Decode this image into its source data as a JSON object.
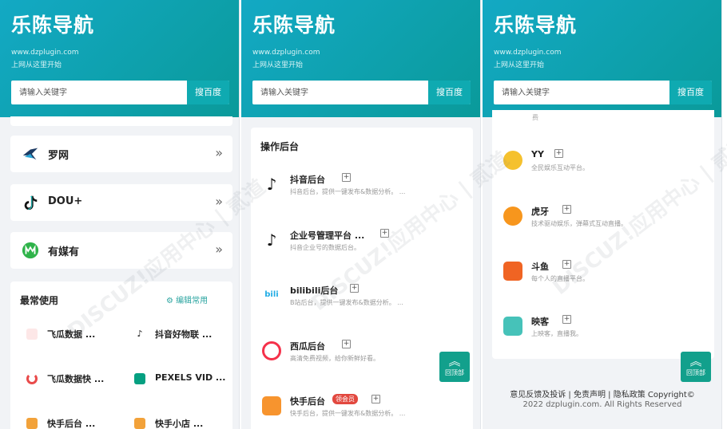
{
  "site": {
    "brand": "乐陈导航",
    "url": "www.dzplugin.com",
    "slogan": "上网从这里开始",
    "search_placeholder": "请输入关键字",
    "search_button": "搜百度"
  },
  "panel1": {
    "nav_cards": [
      {
        "label": "罗网",
        "icon": "luowang-logo-icon"
      },
      {
        "label": "DOU+",
        "icon": "tiktok-icon"
      },
      {
        "label": "有媒有",
        "icon": "youmeiyou-logo-icon"
      }
    ],
    "frequent": {
      "title": "最常使用",
      "edit_label": "编辑常用",
      "items": [
        {
          "label": "飞瓜数据 ...",
          "color": "#e94b4b"
        },
        {
          "label": "抖音好物联 ...",
          "color": "#111111"
        },
        {
          "label": "飞瓜数据快 ...",
          "color": "#e94b4b"
        },
        {
          "label": "PEXELS VID ...",
          "color": "#05a081"
        },
        {
          "label": "快手后台 ...",
          "color": "#f2a23a"
        },
        {
          "label": "快手小店 ...",
          "color": "#f2a23a"
        }
      ]
    }
  },
  "panel2": {
    "section_title": "操作后台",
    "items": [
      {
        "title": "抖音后台",
        "desc": "抖音后台，提供一键发布&数据分析。 ...",
        "color": "#111111"
      },
      {
        "title": "企业号管理平台 ...",
        "desc": "抖音企业号的数据后台。",
        "color": "#111111"
      },
      {
        "title": "bilibili后台",
        "desc": "B站后台，提供一键发布&数据分析。 ...",
        "color": "#23ade5"
      },
      {
        "title": "西瓜后台",
        "desc": "高清免费视频，给你新鲜好看。",
        "color": "#f5314a"
      },
      {
        "title": "快手后台",
        "tag": "领会员",
        "desc": "快手后台，提供一键发布&数据分析。 ...",
        "color": "#f7942e"
      }
    ],
    "to_top": "回顶部"
  },
  "panel3": {
    "top_cut_text": "费",
    "items": [
      {
        "title": "YY",
        "desc": "全民娱乐互动平台。",
        "color": "#f5c12e"
      },
      {
        "title": "虎牙",
        "desc": "技术驱动娱乐，弹幕式互动直播。",
        "color": "#f7961d"
      },
      {
        "title": "斗鱼",
        "desc": "每个人的直播平台。",
        "color": "#f06423"
      },
      {
        "title": "映客",
        "desc": "上映客，直播我。",
        "color": "#46c2b9"
      }
    ],
    "footer_links": "意见反馈及投诉 | 免责声明 | 隐私政策 Copyright©",
    "footer_copy": "2022 dzplugin.com. All Rights Reserved",
    "to_top": "回顶部"
  },
  "watermark": {
    "line1": "DISCUZ!应用中心 | 贰道",
    "line2": "addon.dismall.com"
  }
}
